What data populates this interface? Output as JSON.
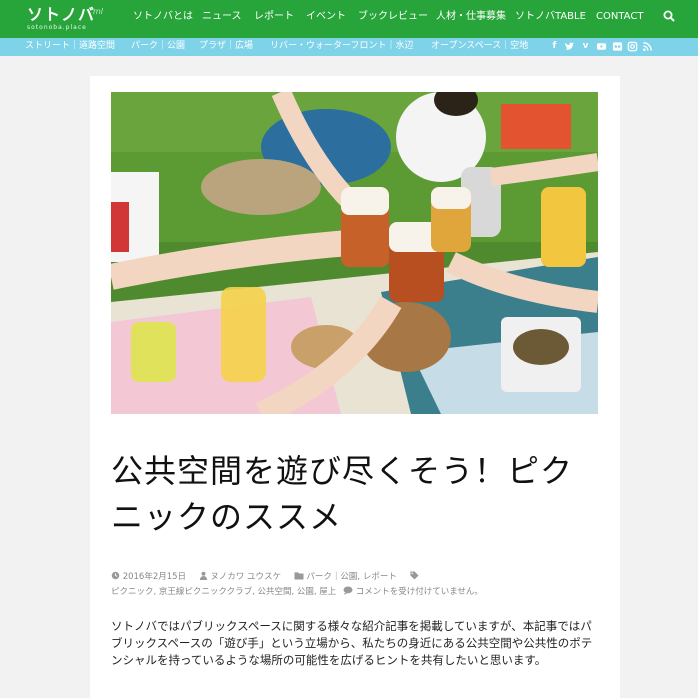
{
  "site": {
    "logo": "ソトノバ",
    "logo_sub": "sotonoba.place",
    "logo_mark": "ml"
  },
  "nav": {
    "items": [
      "ソトノバとは",
      "ニュース",
      "レポート",
      "イベント",
      "ブックレビュー",
      "人材・仕事募集",
      "ソトノバTABLE",
      "CONTACT"
    ]
  },
  "subnav": {
    "items": [
      "ストリート｜道路空間",
      "パーク｜公園",
      "プラザ｜広場",
      "リバー・ウォーターフロント｜水辺",
      "オープンスペース｜空地"
    ],
    "social": [
      "facebook-icon",
      "twitter-icon",
      "vimeo-icon",
      "youtube-icon",
      "flickr-icon",
      "instagram-icon",
      "rss-icon"
    ]
  },
  "article": {
    "title": "公共空間を遊び尽くそう！ピクニックのススメ",
    "date": "2016年2月15日",
    "author": "ヌノカワ ユウスケ",
    "categories": "パーク｜公園, レポート",
    "tags": "ピクニック, 京王線ピクニッククラブ, 公共空間, 公園, 屋上",
    "comments": "コメントを受け付けていません。",
    "body": "ソトノバではパブリックスペースに関する様々な紹介記事を掲載していますが、本記事ではパブリックスペースの「遊び手」という立場から、私たちの身近にある公共空間や公共性のポテンシャルを持っているような場所の可能性を広げるヒントを共有したいと思います。"
  },
  "colors": {
    "nav_bg": "#27a43a",
    "subnav_bg": "#7fd3e8",
    "page_bg": "#f2f2f2"
  }
}
